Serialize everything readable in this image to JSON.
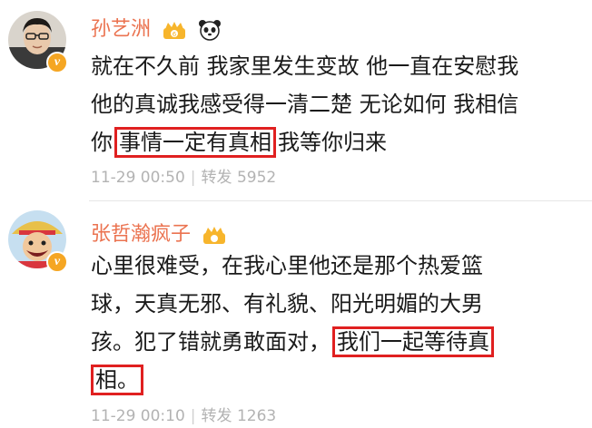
{
  "comments": [
    {
      "username": "孙艺洲",
      "text_lines": [
        {
          "pre": "就在不久前 我家里发生变故 他一直在安慰我",
          "hl": "",
          "post": ""
        },
        {
          "pre": "他的真诚我感受得一清二楚 无论如何 我相信",
          "hl": "",
          "post": ""
        },
        {
          "pre": "你",
          "hl": "事情一定有真相",
          "post": "我等你归来"
        }
      ],
      "timestamp": "11-29 00:50",
      "repost_label": "转发",
      "repost_count": "5952"
    },
    {
      "username": "张哲瀚疯子",
      "text_lines": [
        {
          "pre": "心里很难受，在我心里他还是那个热爱篮",
          "hl": "",
          "post": ""
        },
        {
          "pre": "球，天真无邪、有礼貌、阳光明媚的大男",
          "hl": "",
          "post": ""
        },
        {
          "pre": "孩。犯了错就勇敢面对，",
          "hl": "我们一起等待真",
          "post": ""
        },
        {
          "pre": "",
          "hl": "相。",
          "post": ""
        }
      ],
      "timestamp": "11-29 00:10",
      "repost_label": "转发",
      "repost_count": "1263"
    }
  ],
  "colors": {
    "username": "#eb7350",
    "highlight_box": "#e02020",
    "verified": "#f5a623",
    "meta": "#b3b3b3"
  }
}
